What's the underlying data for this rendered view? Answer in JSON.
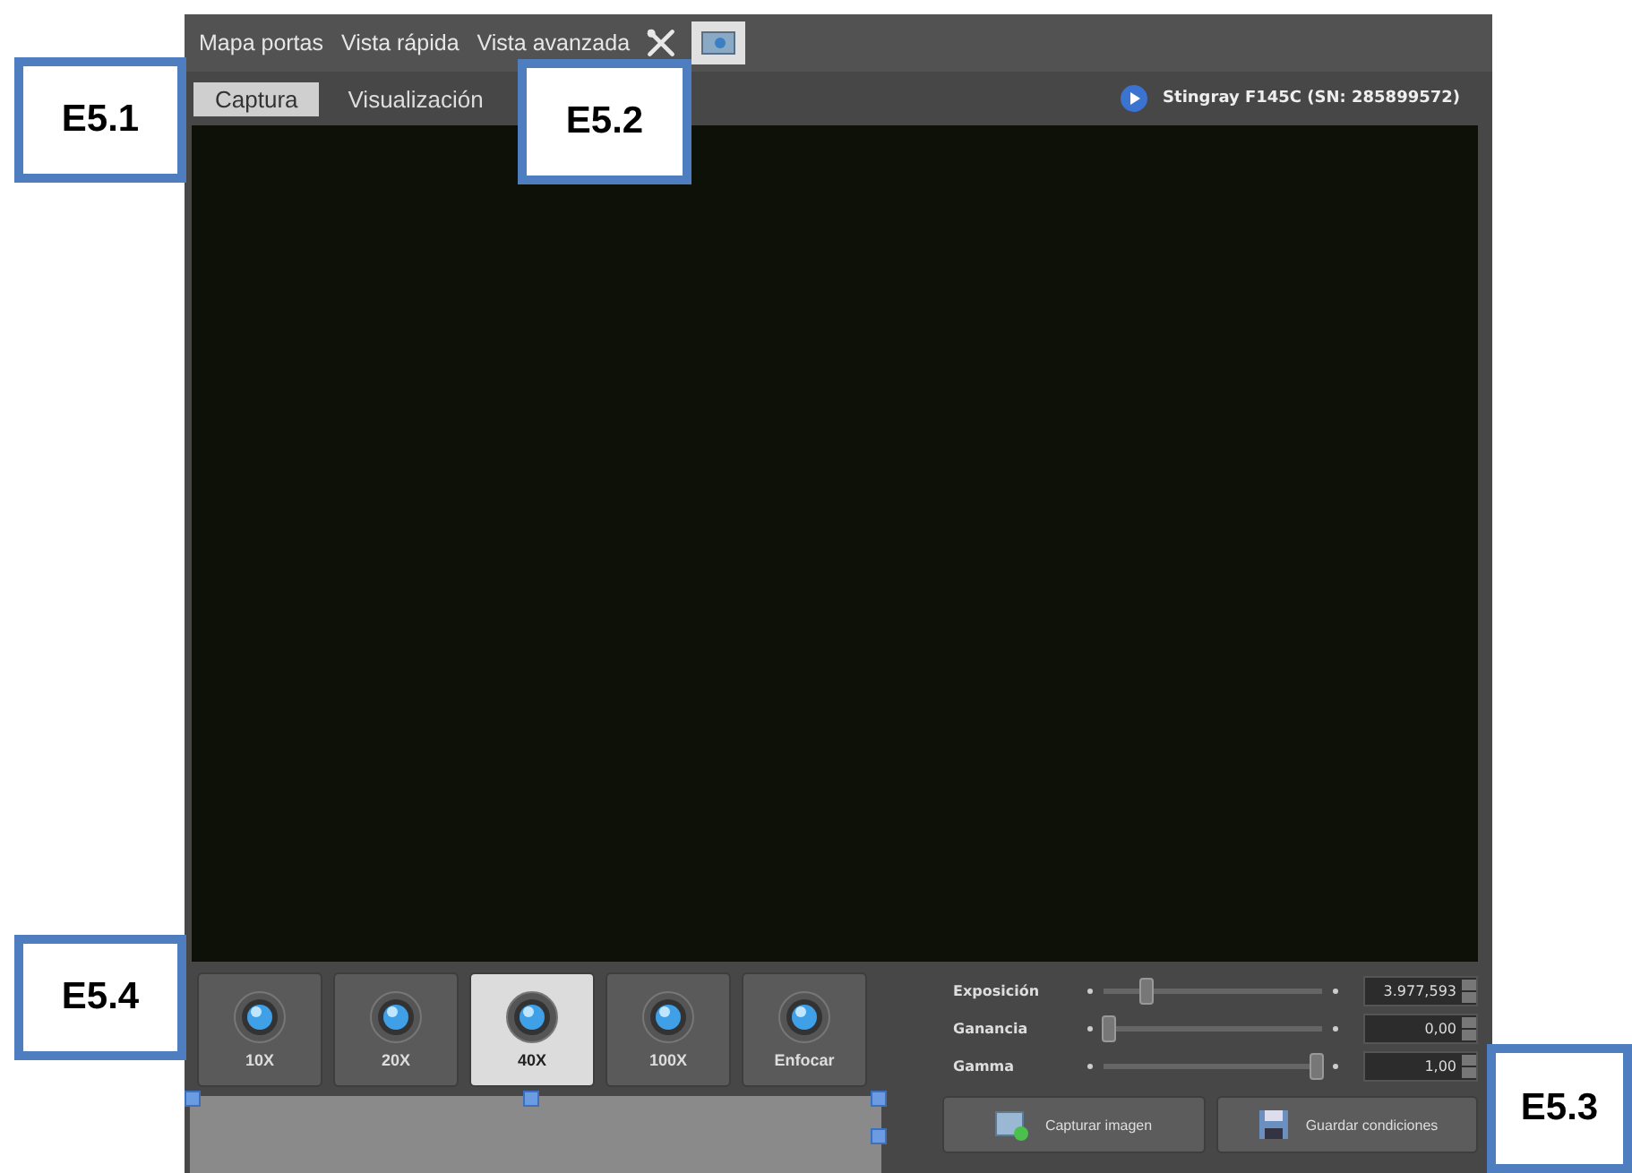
{
  "menu_tabs": [
    {
      "label": "Mapa portas",
      "selected": false
    },
    {
      "label": "Vista rápida",
      "selected": false
    },
    {
      "label": "Vista avanzada",
      "selected": false
    }
  ],
  "view_tabs": [
    {
      "label": "Captura",
      "selected": true
    },
    {
      "label": "Visualización",
      "selected": false
    }
  ],
  "device": {
    "name": "Stingray F145C (SN: 285899572)"
  },
  "objectives": [
    {
      "label": "10X",
      "selected": false
    },
    {
      "label": "20X",
      "selected": false
    },
    {
      "label": "40X",
      "selected": true
    },
    {
      "label": "100X",
      "selected": false
    },
    {
      "label": "Enfocar",
      "selected": false
    }
  ],
  "controls": [
    {
      "name": "Exposición",
      "level": 0.19,
      "value": "3.977,593"
    },
    {
      "name": "Ganancia",
      "level": 0.02,
      "value": "0,00"
    },
    {
      "name": "Gamma",
      "level": 0.97,
      "value": "1,00"
    }
  ],
  "buttons": [
    {
      "kind": "capture",
      "label": "Capturar imagen"
    },
    {
      "kind": "save",
      "label": "Guardar condiciones"
    }
  ],
  "annotations": [
    {
      "label": "E5.1"
    },
    {
      "label": "E5.2"
    },
    {
      "label": "E5.4"
    },
    {
      "label": "E5.3"
    }
  ]
}
